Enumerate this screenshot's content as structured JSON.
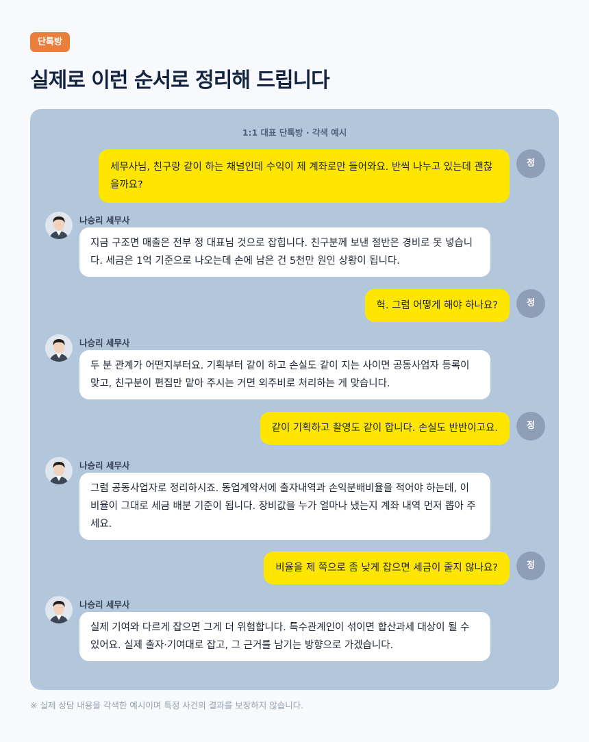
{
  "badge": "단톡방",
  "title": "실제로 이런 순서로 정리해 드립니다",
  "chat": {
    "caption": "1:1 대표 단톡방 · 각색 예시",
    "user_initial": "정",
    "bot_name": "나승리 세무사",
    "messages": [
      {
        "from": "user",
        "text": "세무사님, 친구랑 같이 하는 채널인데 수익이 제 계좌로만 들어와요. 반씩 나누고 있는데 괜찮을까요?"
      },
      {
        "from": "bot",
        "text": "지금 구조면 매출은 전부 정 대표님 것으로 잡힙니다. 친구분께 보낸 절반은 경비로 못 넣습니다. 세금은 1억 기준으로 나오는데 손에 남은 건 5천만 원인 상황이 됩니다."
      },
      {
        "from": "user",
        "text": "헉. 그럼 어떻게 해야 하나요?"
      },
      {
        "from": "bot",
        "text": "두 분 관계가 어떤지부터요. 기획부터 같이 하고 손실도 같이 지는 사이면 공동사업자 등록이 맞고, 친구분이 편집만 맡아 주시는 거면 외주비로 처리하는 게 맞습니다."
      },
      {
        "from": "user",
        "text": "같이 기획하고 촬영도 같이 합니다. 손실도 반반이고요."
      },
      {
        "from": "bot",
        "text": "그럼 공동사업자로 정리하시죠. 동업계약서에 출자내역과 손익분배비율을 적어야 하는데, 이 비율이 그대로 세금 배분 기준이 됩니다. 장비값을 누가 얼마나 냈는지 계좌 내역 먼저 뽑아 주세요."
      },
      {
        "from": "user",
        "text": "비율을 제 쪽으로 좀 낮게 잡으면 세금이 줄지 않나요?"
      },
      {
        "from": "bot",
        "text": "실제 기여와 다르게 잡으면 그게 더 위험합니다. 특수관계인이 섞이면 합산과세 대상이 될 수 있어요. 실제 출자·기여대로 잡고, 그 근거를 남기는 방향으로 가겠습니다."
      }
    ]
  },
  "disclaimer": "※ 실제 상담 내용을 각색한 예시이며 특정 사건의 결과를 보장하지 않습니다.",
  "colors": {
    "badge": "#ea7f3c",
    "panel": "#b2c7db",
    "user_bubble": "#ffe600",
    "bot_bubble": "#ffffff",
    "user_avatar": "#8d9eb6",
    "title": "#14233f"
  }
}
